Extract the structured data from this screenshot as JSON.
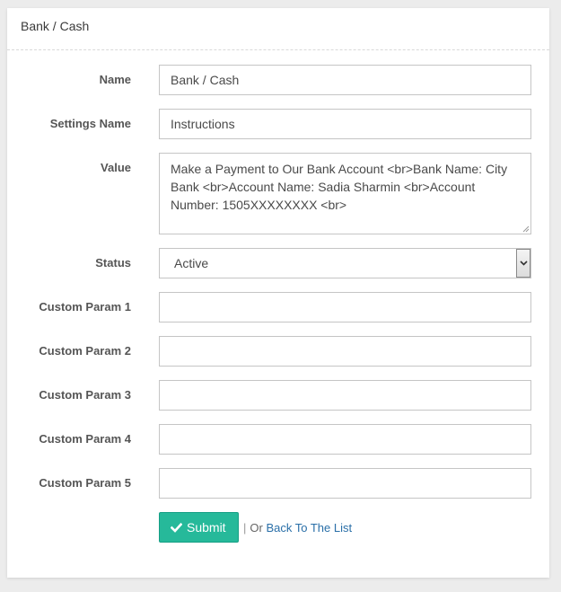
{
  "panel": {
    "title": "Bank / Cash"
  },
  "form": {
    "name": {
      "label": "Name",
      "value": "Bank / Cash"
    },
    "settings_name": {
      "label": "Settings Name",
      "value": "Instructions"
    },
    "value": {
      "label": "Value",
      "value": "Make a Payment to Our Bank Account <br>Bank Name: City Bank <br>Account Name: Sadia Sharmin <br>Account Number: 1505XXXXXXXX <br>"
    },
    "status": {
      "label": "Status",
      "selected": "Active"
    },
    "custom_params": [
      {
        "label": "Custom Param 1",
        "value": ""
      },
      {
        "label": "Custom Param 2",
        "value": ""
      },
      {
        "label": "Custom Param 3",
        "value": ""
      },
      {
        "label": "Custom Param 4",
        "value": ""
      },
      {
        "label": "Custom Param 5",
        "value": ""
      }
    ]
  },
  "actions": {
    "submit_label": "Submit",
    "separator": "|",
    "or_text": "Or",
    "back_link": "Back To The List"
  },
  "colors": {
    "submit_bg": "#26b99a",
    "link": "#2a6fa8"
  },
  "icons": {
    "submit": "check-icon",
    "status_select": "chevron-down-icon"
  }
}
